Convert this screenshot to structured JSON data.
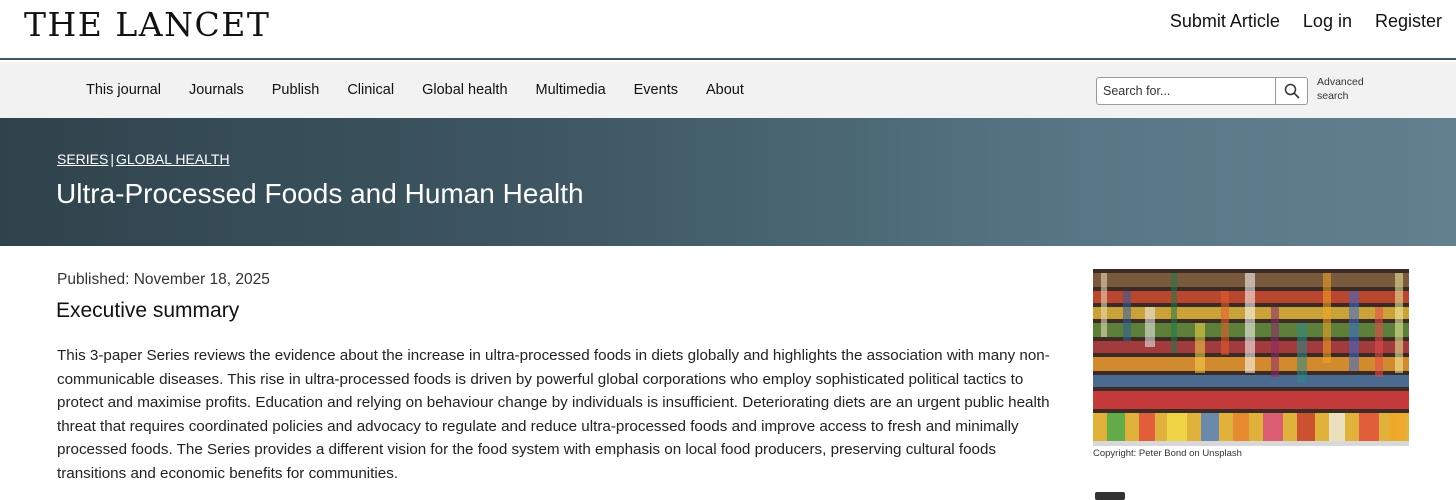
{
  "header": {
    "logo": "THE LANCET",
    "account_links": [
      "Submit Article",
      "Log in",
      "Register"
    ]
  },
  "nav": {
    "items": [
      "This journal",
      "Journals",
      "Publish",
      "Clinical",
      "Global health",
      "Multimedia",
      "Events",
      "About"
    ],
    "search_placeholder": "Search for...",
    "advanced_search_line1": "Advanced",
    "advanced_search_line2": "search"
  },
  "hero": {
    "breadcrumb_series": "SERIES",
    "breadcrumb_separator": "|",
    "breadcrumb_topic": "GLOBAL HEALTH",
    "title": "Ultra-Processed Foods and Human Health"
  },
  "article": {
    "published": "Published: November 18, 2025",
    "section_heading": "Executive summary",
    "summary": "This 3-paper Series reviews the evidence about the increase in ultra-processed foods in diets globally and highlights the association with many non-communicable diseases. This rise in ultra-processed foods is driven by powerful global corporations who employ sophisticated political tactics to protect and maximise profits. Education and relying on behaviour change by individuals is insufficient. Deteriorating diets are an urgent public health threat that requires coordinated policies and advocacy to regulate and reduce ultra-processed foods and improve access to fresh and minimally processed foods. The Series provides a different vision for the food system with emphasis on local food producers, preserving cultural foods transitions and economic benefits for communities."
  },
  "figure": {
    "image_label": "supermarket-shelves-photo",
    "caption": "Copyright: Peter Bond on Unsplash"
  },
  "colors": {
    "hero_dark": "#2f434c",
    "hero_light": "#62808e",
    "nav_bg": "#f2f2f2",
    "divider": "#3f5964"
  }
}
